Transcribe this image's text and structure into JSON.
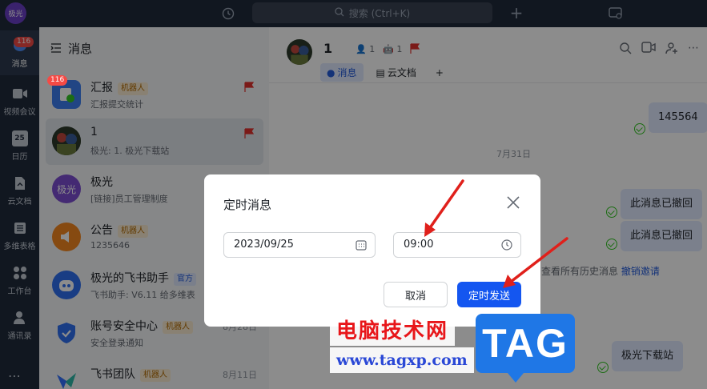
{
  "topbar": {
    "app_avatar": "极光",
    "search_placeholder": "搜索 (Ctrl+K)",
    "plus": "+"
  },
  "rail": {
    "badge": "116",
    "items": [
      {
        "label": "消息",
        "icon": "chat-bubble-icon"
      },
      {
        "label": "视频会议",
        "icon": "video-icon"
      },
      {
        "label": "日历",
        "icon": "calendar-icon"
      },
      {
        "label": "云文档",
        "icon": "doc-icon"
      },
      {
        "label": "多维表格",
        "icon": "table-icon"
      },
      {
        "label": "工作台",
        "icon": "grid-icon"
      },
      {
        "label": "通讯录",
        "icon": "contacts-icon"
      }
    ],
    "calendar_day": "25"
  },
  "list": {
    "title": "消息",
    "conversations": [
      {
        "name": "汇报",
        "tag": "机器人",
        "preview": "汇报提交统计",
        "badge": "116",
        "flag": true,
        "avatar_text": ""
      },
      {
        "name": "1",
        "tag": "",
        "preview": "极光: 1. 极光下载站",
        "flag": true,
        "avatar_text": ""
      },
      {
        "name": "极光",
        "tag": "",
        "preview": "[链接]员工管理制度",
        "avatar_text": "极光"
      },
      {
        "name": "公告",
        "tag": "机器人",
        "preview": "1235646",
        "avatar_text": ""
      },
      {
        "name": "极光的飞书助手",
        "tag": "官方",
        "preview": "飞书助手: V6.11 给多维表",
        "avatar_text": ""
      },
      {
        "name": "账号安全中心",
        "tag": "机器人",
        "preview": "安全登录通知",
        "date": "8月28日",
        "avatar_text": ""
      },
      {
        "name": "飞书团队",
        "tag": "机器人",
        "preview": "",
        "date": "8月11日",
        "avatar_text": ""
      }
    ]
  },
  "chat": {
    "title": "1",
    "members": "1",
    "bots": "1",
    "tabs": [
      {
        "label": "消息"
      },
      {
        "label": "云文档"
      }
    ],
    "messages": [
      {
        "text": "145564"
      },
      {
        "text": "此消息已撤回"
      },
      {
        "text": "此消息已撤回"
      },
      {
        "text": "极光下载站"
      }
    ],
    "date_separator": "7月31日",
    "history_text": "查看所有历史消息",
    "history_link": "撤销邀请"
  },
  "modal": {
    "title": "定时消息",
    "date_value": "2023/09/25",
    "time_value": "09:00",
    "cancel_label": "取消",
    "send_label": "定时发送"
  },
  "watermark": {
    "cn": "电脑技术网",
    "url": "www.tagxp.com",
    "tag": "TAG"
  }
}
